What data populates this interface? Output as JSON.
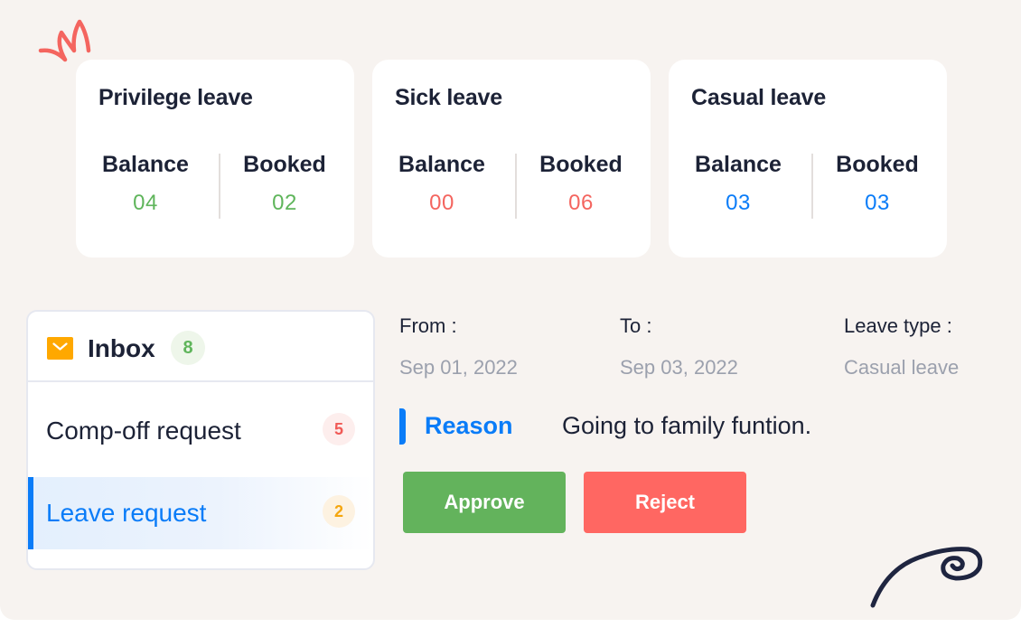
{
  "colors": {
    "green": "#63b35c",
    "red": "#ff6762",
    "blue": "#0a7cf8",
    "amber": "#ffa800",
    "background": "#f7f3f0",
    "text_dark": "#1c2236",
    "text_muted": "#9ba0ad"
  },
  "leave_cards": [
    {
      "title": "Privilege leave",
      "balance_label": "Balance",
      "balance": "04",
      "booked_label": "Booked",
      "booked": "02",
      "accent": "#5fb55b"
    },
    {
      "title": "Sick leave",
      "balance_label": "Balance",
      "balance": "00",
      "booked_label": "Booked",
      "booked": "06",
      "accent": "#f4655f"
    },
    {
      "title": "Casual leave",
      "balance_label": "Balance",
      "balance": "03",
      "booked_label": "Booked",
      "booked": "03",
      "accent": "#0a7cf8"
    }
  ],
  "inbox": {
    "icon": "mail-icon",
    "title": "Inbox",
    "count": "8",
    "items": [
      {
        "label": "Comp-off request",
        "count": "5",
        "active": false
      },
      {
        "label": "Leave request",
        "count": "2",
        "active": true
      }
    ]
  },
  "request": {
    "from_label": "From :",
    "from_value": "Sep 01, 2022",
    "to_label": "To :",
    "to_value": "Sep 03, 2022",
    "type_label": "Leave type :",
    "type_value": "Casual leave",
    "reason_label": "Reason",
    "reason_text": "Going to family funtion."
  },
  "actions": {
    "approve_label": "Approve",
    "reject_label": "Reject"
  }
}
